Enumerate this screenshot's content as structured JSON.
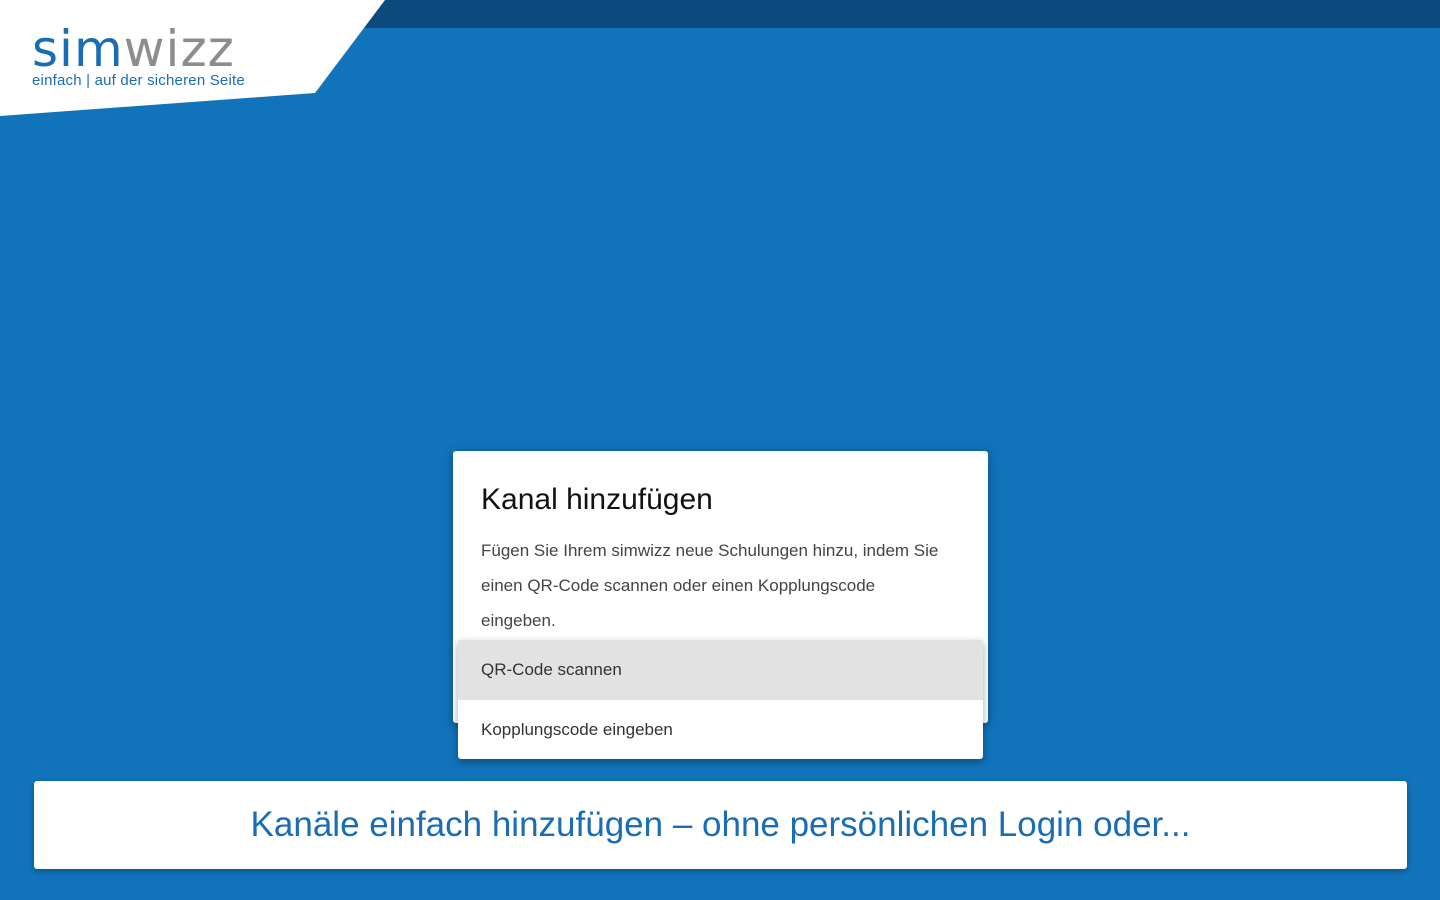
{
  "logo": {
    "wordmark_part1": "sim",
    "wordmark_part2": "wizz",
    "tagline": "einfach | auf der sicheren Seite",
    "colors": {
      "blue": "#1a6db5",
      "gray": "#8d8d8d"
    }
  },
  "dialog": {
    "title": "Kanal hinzufügen",
    "body": "Fügen Sie Ihrem simwizz neue Schulungen hinzu, indem Sie einen QR-Code scannen oder einen Kopplungscode eingeben."
  },
  "menu": {
    "items": [
      {
        "label": "QR-Code scannen",
        "highlighted": true
      },
      {
        "label": "Kopplungscode eingeben",
        "highlighted": false
      }
    ]
  },
  "banner": {
    "caption": "Kanäle einfach hinzufügen – ohne persönlichen Login oder..."
  },
  "colors": {
    "background": "#1173ba",
    "top_bar": "#0c4a7d",
    "accent": "#1a6db5"
  }
}
